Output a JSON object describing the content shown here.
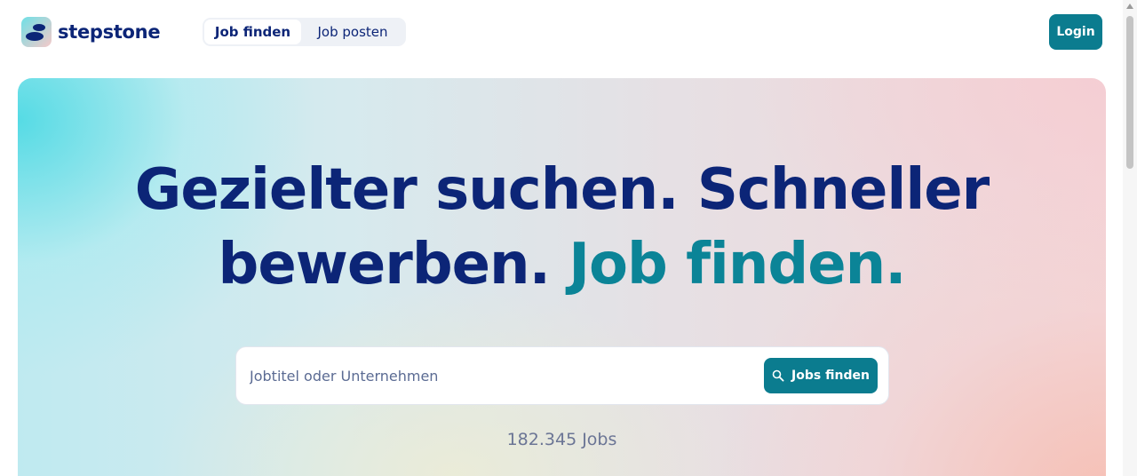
{
  "header": {
    "brand": "stepstone",
    "tabs": [
      {
        "label": "Job finden",
        "active": true
      },
      {
        "label": "Job posten",
        "active": false
      }
    ],
    "login_label": "Login"
  },
  "hero": {
    "headline_primary": "Gezielter suchen. Schneller bewerben.",
    "headline_accent": "Job finden.",
    "search": {
      "placeholder": "Jobtitel oder Unternehmen",
      "value": "",
      "button_label": "Jobs finden",
      "button_icon": "search-icon"
    },
    "job_count": "182.345 Jobs"
  },
  "colors": {
    "brand_dark": "#0c2577",
    "brand_teal": "#0b7c8f"
  }
}
